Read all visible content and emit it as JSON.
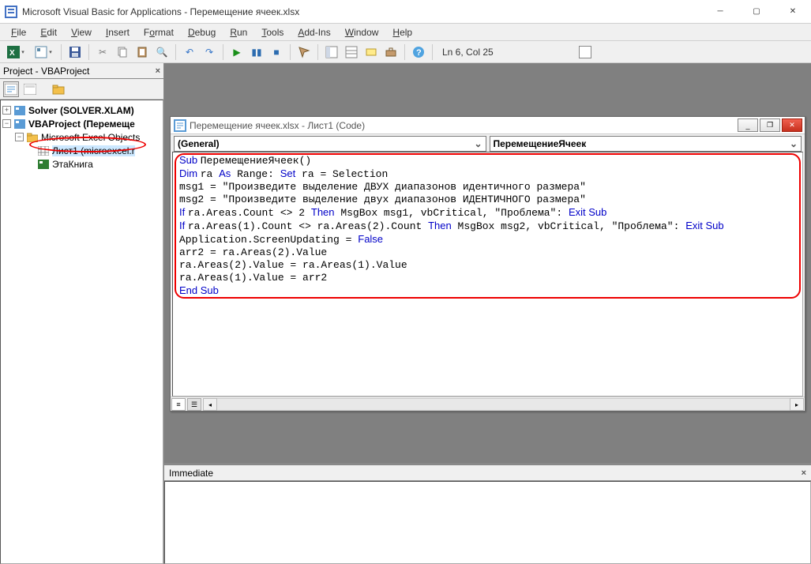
{
  "app": {
    "title": "Microsoft Visual Basic for Applications - Перемещение ячеек.xlsx"
  },
  "menu": [
    "File",
    "Edit",
    "View",
    "Insert",
    "Format",
    "Debug",
    "Run",
    "Tools",
    "Add-Ins",
    "Window",
    "Help"
  ],
  "toolbar": {
    "cursor_pos": "Ln 6, Col 25"
  },
  "project": {
    "title": "Project - VBAProject",
    "nodes": {
      "solver": "Solver (SOLVER.XLAM)",
      "vba": "VBAProject (Перемеще",
      "mso": "Microsoft Excel Objects",
      "sheet1": "Лист1 (microexcel.r",
      "thisbook": "ЭтаКнига"
    }
  },
  "code_win": {
    "title": "Перемещение ячеек.xlsx - Лист1 (Code)",
    "drop_left": "(General)",
    "drop_right": "ПеремещениеЯчеек",
    "code_lines": [
      {
        "t": "Sub ",
        "k": 1
      },
      {
        "t": "ПеремещениеЯчеек()\n"
      },
      {
        "t": "Dim ",
        "k": 1
      },
      {
        "t": "ra "
      },
      {
        "t": "As",
        "k": 1
      },
      {
        "t": " Range: "
      },
      {
        "t": "Set",
        "k": 1
      },
      {
        "t": " ra = Selection\n"
      },
      {
        "t": "msg1 = \"Произведите выделение ДВУХ диапазонов идентичного размера\"\n"
      },
      {
        "t": "msg2 = \"Произведите выделение двух диапазонов ИДЕНТИЧНОГО размера\"\n"
      },
      {
        "t": "If ",
        "k": 1
      },
      {
        "t": "ra.Areas.Count <> 2 "
      },
      {
        "t": "Then",
        "k": 1
      },
      {
        "t": " MsgBox msg1, vbCritical, \"Проблема\": "
      },
      {
        "t": "Exit Sub",
        "k": 1
      },
      {
        "t": "\n"
      },
      {
        "t": "If ",
        "k": 1
      },
      {
        "t": "ra.Areas(1).Count <> ra.Areas(2).Count "
      },
      {
        "t": "Then",
        "k": 1
      },
      {
        "t": " MsgBox msg2, vbCritical, \"Проблема\": "
      },
      {
        "t": "Exit Sub",
        "k": 1
      },
      {
        "t": "\n"
      },
      {
        "t": "Application.ScreenUpdating = "
      },
      {
        "t": "False",
        "k": 1
      },
      {
        "t": "\n"
      },
      {
        "t": "arr2 = ra.Areas(2).Value\n"
      },
      {
        "t": "ra.Areas(2).Value = ra.Areas(1).Value\n"
      },
      {
        "t": "ra.Areas(1).Value = arr2\n"
      },
      {
        "t": "End Sub",
        "k": 1
      }
    ]
  },
  "immediate": {
    "title": "Immediate"
  }
}
